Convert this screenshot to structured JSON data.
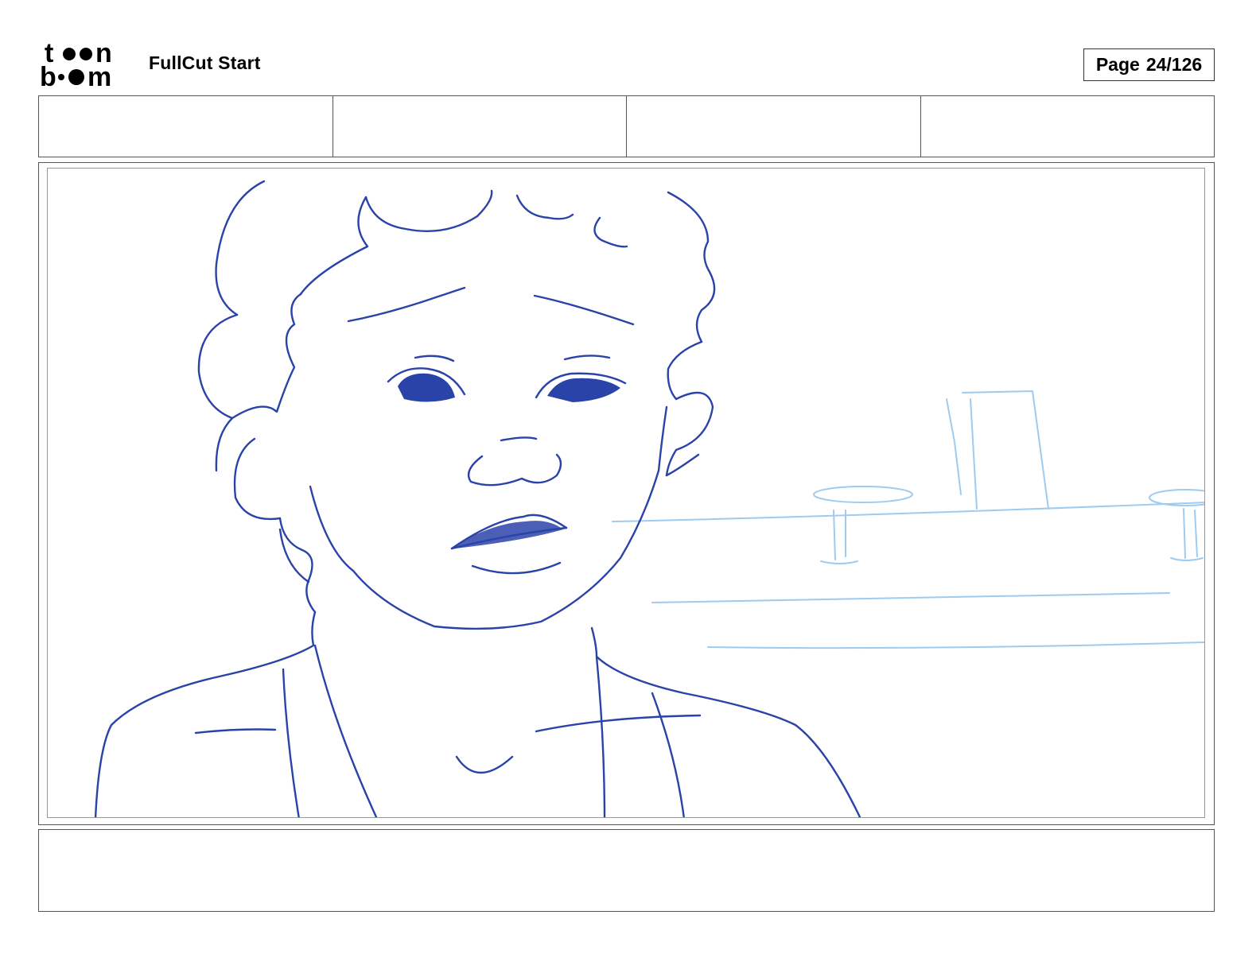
{
  "header": {
    "logo": {
      "text": "toonboom",
      "icon": "toonboom-logo-icon"
    },
    "project_title": "FullCut Start",
    "page": {
      "label": "Page",
      "value": "24/126"
    }
  },
  "fields": [
    "",
    "",
    "",
    ""
  ],
  "panel": {
    "drawing": "storyboard-sketch",
    "colors": {
      "character_line": "#2a43a8",
      "background_line": "#9fcbf0"
    }
  },
  "caption": {
    "text": ""
  }
}
